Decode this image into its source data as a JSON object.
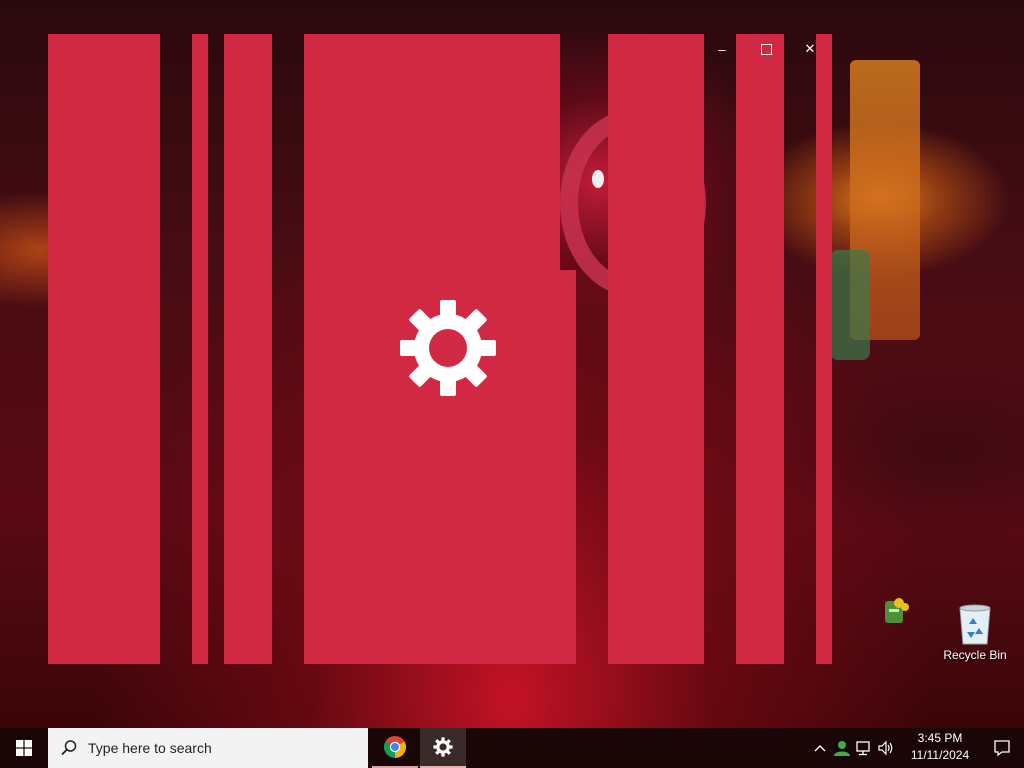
{
  "splash": {
    "background_color": "#d12843",
    "icon": "gear-icon",
    "window_controls": {
      "minimize_label": "–",
      "maximize_icon": "maximize-icon",
      "close_label": "✕"
    }
  },
  "desktop": {
    "icons": [
      {
        "label": "Recycle Bin",
        "icon": "recycle-bin-icon"
      },
      {
        "label": "",
        "icon": "app-shortcut-icon"
      }
    ]
  },
  "taskbar": {
    "start_icon": "windows-logo-icon",
    "search": {
      "placeholder": "Type here to search",
      "icon": "search-icon"
    },
    "pinned_apps": [
      {
        "name": "Google Chrome",
        "icon": "chrome-icon"
      },
      {
        "name": "Settings",
        "icon": "gear-icon",
        "active": true
      }
    ],
    "tray": {
      "icons": [
        "chevron-up-icon",
        "people-icon",
        "network-icon",
        "volume-icon"
      ],
      "time": "3:45 PM",
      "date": "11/11/2024",
      "notification_icon": "action-center-icon"
    }
  },
  "colors": {
    "taskbar_bg": "#1a0606",
    "splash_red": "#d12843",
    "search_bg": "#f3f3f3"
  }
}
